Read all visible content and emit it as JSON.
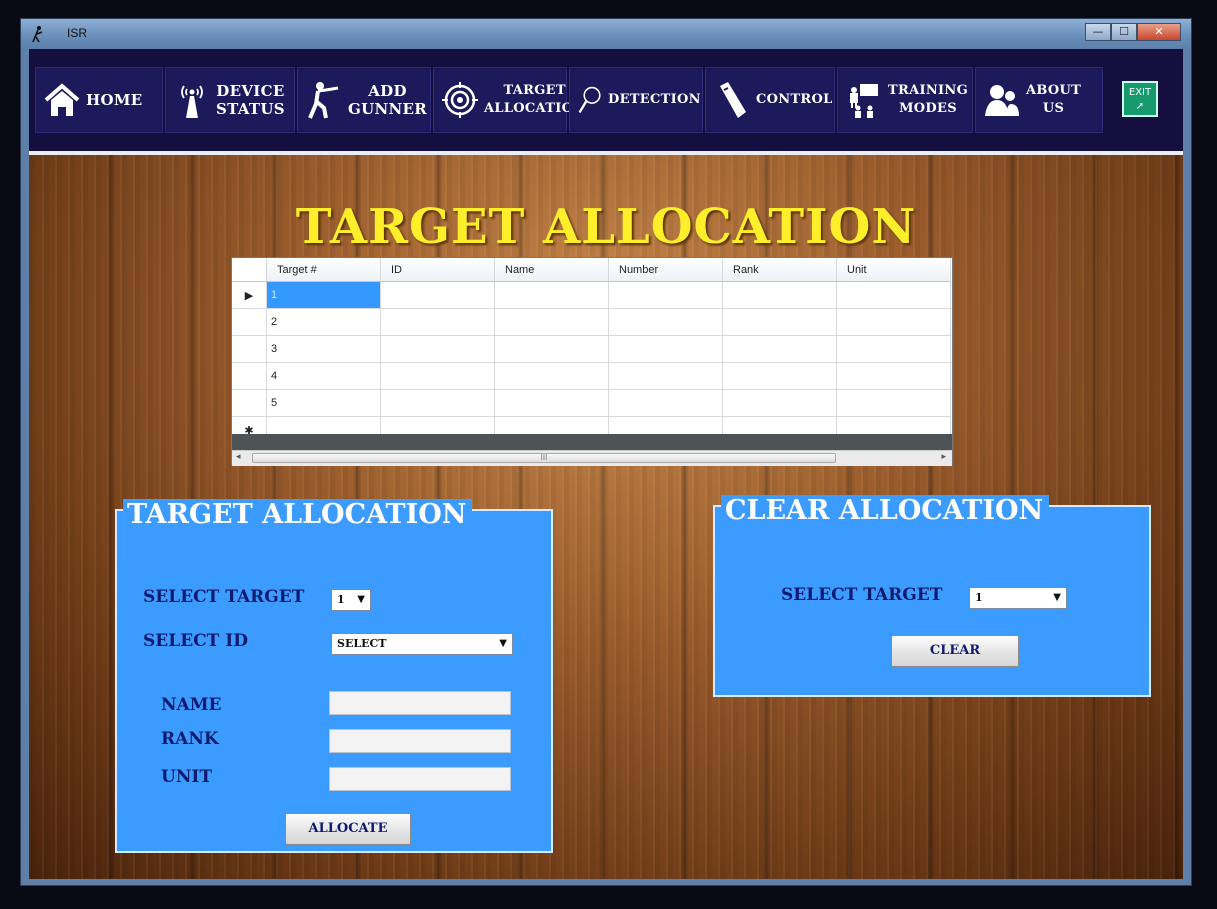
{
  "window": {
    "title": "ISR",
    "controls": {
      "minimize": "—",
      "maximize": "☐",
      "close": "✕"
    }
  },
  "nav": {
    "home": "HOME",
    "device_status": [
      "DEVICE",
      "STATUS"
    ],
    "add_gunner": [
      "ADD",
      "GUNNER"
    ],
    "target_allocation": [
      "TARGET",
      "ALLOCATION"
    ],
    "detection": "DETECTION",
    "control": "CONTROL",
    "training_modes": [
      "TRAINING",
      "MODES"
    ],
    "about_us": [
      "ABOUT",
      "US"
    ],
    "exit": [
      "EXIT",
      "➚"
    ]
  },
  "page_title": "TARGET ALLOCATION",
  "grid": {
    "columns": [
      "Target #",
      "ID",
      "Name",
      "Number",
      "Rank",
      "Unit"
    ],
    "rows": [
      [
        "1",
        "",
        "",
        "",
        "",
        ""
      ],
      [
        "2",
        "",
        "",
        "",
        "",
        ""
      ],
      [
        "3",
        "",
        "",
        "",
        "",
        ""
      ],
      [
        "4",
        "",
        "",
        "",
        "",
        ""
      ],
      [
        "5",
        "",
        "",
        "",
        "",
        ""
      ]
    ],
    "current_row_marker": "▶",
    "new_row_marker": "✱",
    "scroll": {
      "left": "◂",
      "right": "▸",
      "grip": "III"
    }
  },
  "allocation_panel": {
    "legend": "TARGET ALLOCATION",
    "select_target_label": "SELECT TARGET",
    "select_target_value": "1",
    "select_id_label": "SELECT ID",
    "select_id_value": "SELECT",
    "name_label": "NAME",
    "rank_label": "RANK",
    "unit_label": "UNIT",
    "name_value": "",
    "rank_value": "",
    "unit_value": "",
    "allocate_button": "ALLOCATE"
  },
  "clear_panel": {
    "legend": "CLEAR ALLOCATION",
    "select_target_label": "SELECT TARGET",
    "select_target_value": "1",
    "clear_button": "CLEAR"
  },
  "dropdown_arrow": "▼",
  "colors": {
    "nav_bg": "#140f3e",
    "title_yellow": "#ffef2a",
    "panel_blue": "#3b9bff",
    "label_navy": "#0f1a6e",
    "selected_cell": "#3399ff"
  }
}
